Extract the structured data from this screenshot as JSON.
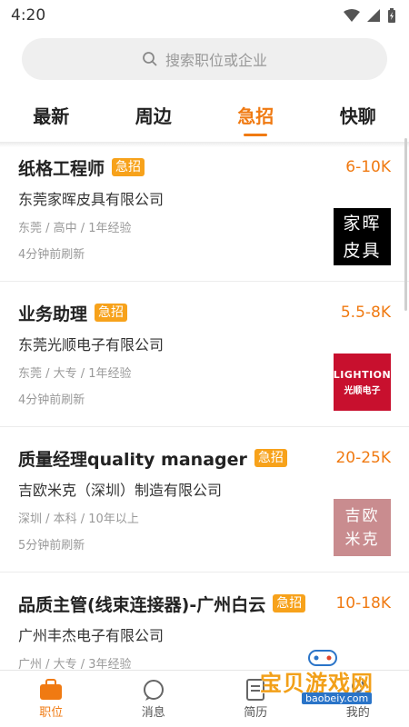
{
  "status": {
    "time": "4:20"
  },
  "search": {
    "placeholder": "搜索职位或企业"
  },
  "tabs": [
    {
      "label": "最新",
      "active": false
    },
    {
      "label": "周边",
      "active": false
    },
    {
      "label": "急招",
      "active": true
    },
    {
      "label": "快聊",
      "active": false
    }
  ],
  "jobs": [
    {
      "title": "纸格工程师",
      "badge": "急招",
      "salary": "6-10K",
      "company": "东莞家晖皮具有限公司",
      "meta": "东莞 / 高中 / 1年经验",
      "refreshed": "4分钟前刷新",
      "logo_lines": [
        "家晖",
        "皮具"
      ]
    },
    {
      "title": "业务助理",
      "badge": "急招",
      "salary": "5.5-8K",
      "company": "东莞光顺电子有限公司",
      "meta": "东莞 / 大专 / 1年经验",
      "refreshed": "4分钟前刷新",
      "logo_lines": [
        "LIGHTION",
        "光顺电子"
      ]
    },
    {
      "title": "质量经理quality manager",
      "badge": "急招",
      "salary": "20-25K",
      "company": "吉欧米克（深圳）制造有限公司",
      "meta": "深圳 / 本科 / 10年以上",
      "refreshed": "5分钟前刷新",
      "logo_lines": [
        "吉欧",
        "米克"
      ]
    },
    {
      "title": "品质主管(线束连接器)-广州白云",
      "badge": "急招",
      "salary": "10-18K",
      "company": "广州丰杰电子有限公司",
      "meta": "广州 / 大专 / 3年经验",
      "refreshed": "",
      "logo_lines": []
    }
  ],
  "bottom_nav": [
    {
      "label": "职位",
      "icon": "briefcase-icon",
      "active": true
    },
    {
      "label": "消息",
      "icon": "chat-bubble-icon",
      "active": false
    },
    {
      "label": "简历",
      "icon": "resume-icon",
      "active": false
    },
    {
      "label": "我的",
      "icon": "profile-icon",
      "active": false
    }
  ],
  "watermark": {
    "text": "宝贝游戏网",
    "url": "baobeiy.com"
  },
  "colors": {
    "accent": "#f07a12",
    "badge": "#f7a21b"
  }
}
